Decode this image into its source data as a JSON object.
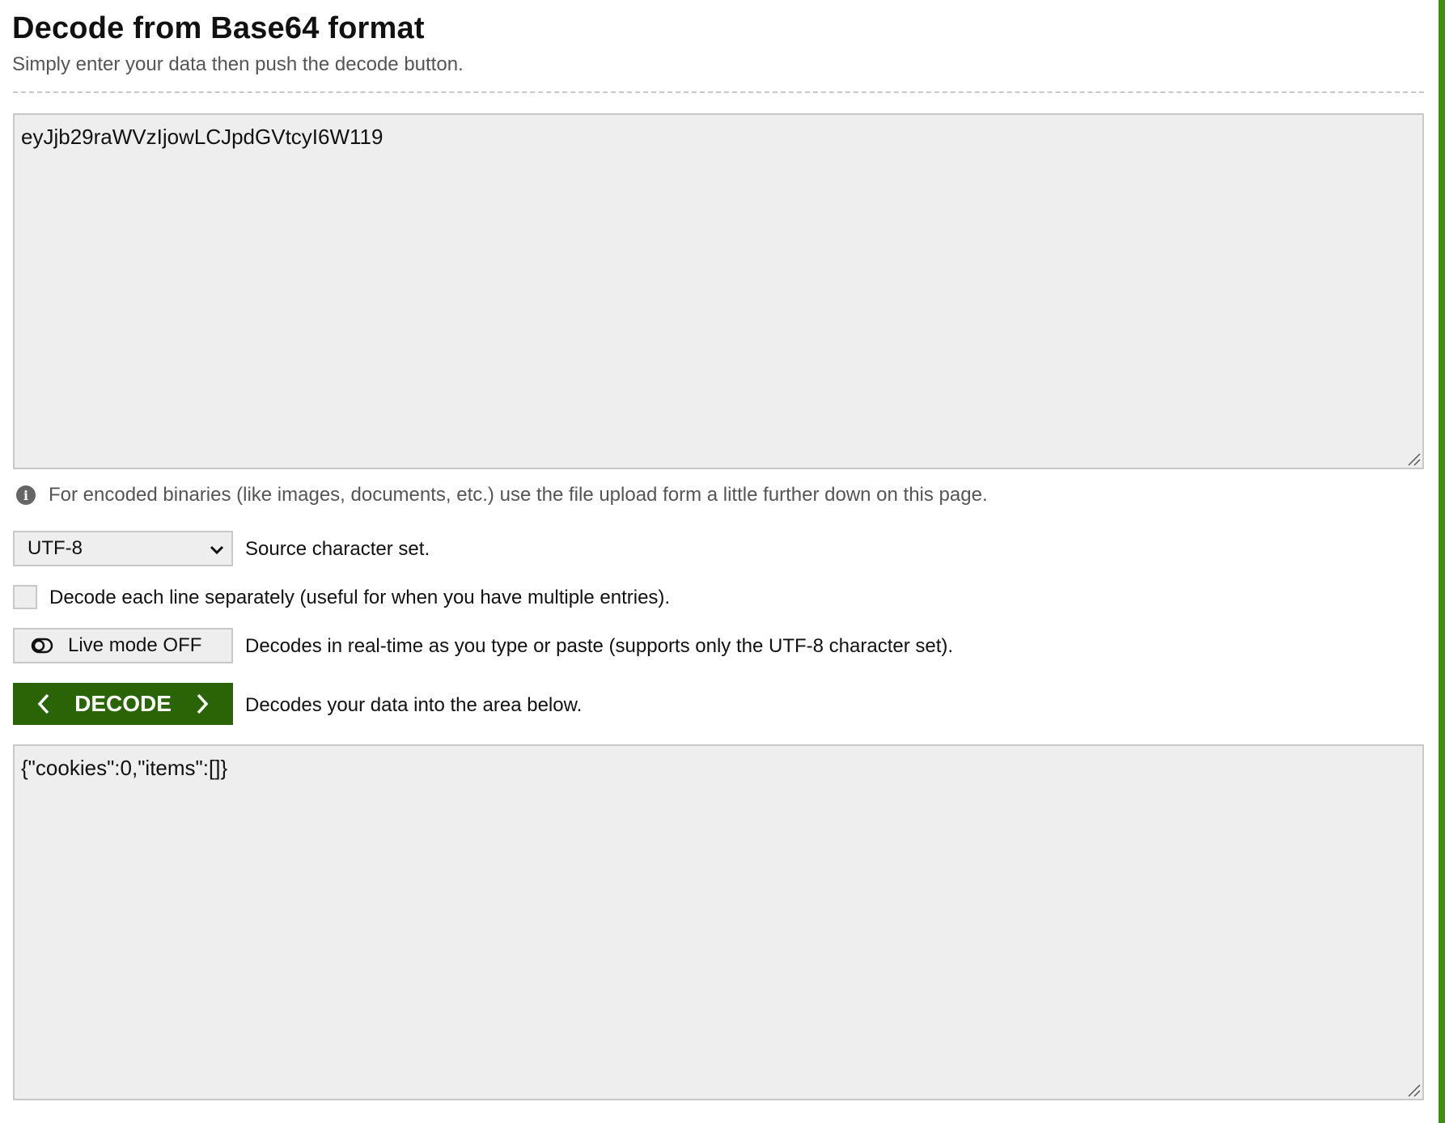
{
  "header": {
    "title": "Decode from Base64 format",
    "subtitle": "Simply enter your data then push the decode button."
  },
  "input": {
    "value": "eyJjb29raWVzIjowLCJpdGVtcyI6W119"
  },
  "note": {
    "icon": "info-icon",
    "text": "For encoded binaries (like images, documents, etc.) use the file upload form a little further down on this page."
  },
  "charset": {
    "selected": "UTF-8",
    "label": "Source character set."
  },
  "line_option": {
    "checked": false,
    "label": "Decode each line separately (useful for when you have multiple entries)."
  },
  "live_mode": {
    "button_label": "Live mode OFF",
    "description": "Decodes in real-time as you type or paste (supports only the UTF-8 character set)."
  },
  "decode": {
    "button_label": "DECODE",
    "description": "Decodes your data into the area below."
  },
  "output": {
    "value": "{\"cookies\":0,\"items\":[]}"
  },
  "colors": {
    "accent_green": "#2a6407",
    "edge_green": "#3f8f0f",
    "field_bg": "#eeeeee",
    "field_border": "#c8c8c8"
  }
}
